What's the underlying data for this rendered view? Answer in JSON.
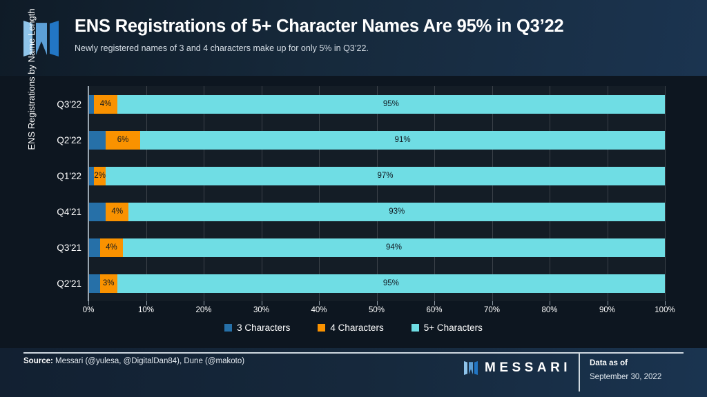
{
  "header": {
    "title": "ENS Registrations of 5+ Character Names Are 95% in Q3’22",
    "subtitle": "Newly registered names of 3 and 4 characters make up for only 5% in Q3’22.",
    "logo_icon": "messari-m-logo-icon"
  },
  "footer": {
    "source_label": "Source:",
    "source_text": " Messari (@yulesa, @DigitalDan84), Dune (@makoto)",
    "brand": "MESSARI",
    "brand_logo_icon": "messari-m-logo-icon",
    "data_as_of_label": "Data as of",
    "data_as_of_date": "September 30, 2022"
  },
  "colors": {
    "series_3char": "#2670A8",
    "series_4char": "#FA9200",
    "series_5plus": "#6FDDE4",
    "plot_background": "#141D26",
    "page_background": "#0D1620",
    "axis": "#9AA6B0",
    "gridline": "#3B4249",
    "text": "#FFFFFF"
  },
  "chart_data": {
    "type": "bar",
    "orientation": "horizontal",
    "stacked": true,
    "normalized": "100%",
    "title": "ENS Registrations of 5+ Character Names Are 95% in Q3’22",
    "subtitle": "Newly registered names of 3 and 4 characters make up for only 5% in Q3’22.",
    "xlabel": "",
    "ylabel": "ENS Registrations by Name Length",
    "xlim": [
      0,
      100
    ],
    "grid": true,
    "legend_position": "bottom",
    "xtick_labels": [
      "0%",
      "10%",
      "20%",
      "30%",
      "40%",
      "50%",
      "60%",
      "70%",
      "80%",
      "90%",
      "100%"
    ],
    "xtick_values": [
      0,
      10,
      20,
      30,
      40,
      50,
      60,
      70,
      80,
      90,
      100
    ],
    "categories": [
      "Q3'22",
      "Q2'22",
      "Q1'22",
      "Q4'21",
      "Q3'21",
      "Q2'21"
    ],
    "series": [
      {
        "name": "3 Characters",
        "color": "#2670A8",
        "values": [
          1,
          3,
          1,
          3,
          2,
          2
        ],
        "labels": [
          "",
          "",
          "",
          "",
          "",
          ""
        ]
      },
      {
        "name": "4 Characters",
        "color": "#FA9200",
        "values": [
          4,
          6,
          2,
          4,
          4,
          3
        ],
        "labels": [
          "4%",
          "6%",
          "2%",
          "4%",
          "4%",
          "3%"
        ]
      },
      {
        "name": "5+ Characters",
        "color": "#6FDDE4",
        "values": [
          95,
          91,
          97,
          93,
          94,
          95
        ],
        "labels": [
          "95%",
          "91%",
          "97%",
          "93%",
          "94%",
          "95%"
        ]
      }
    ]
  }
}
